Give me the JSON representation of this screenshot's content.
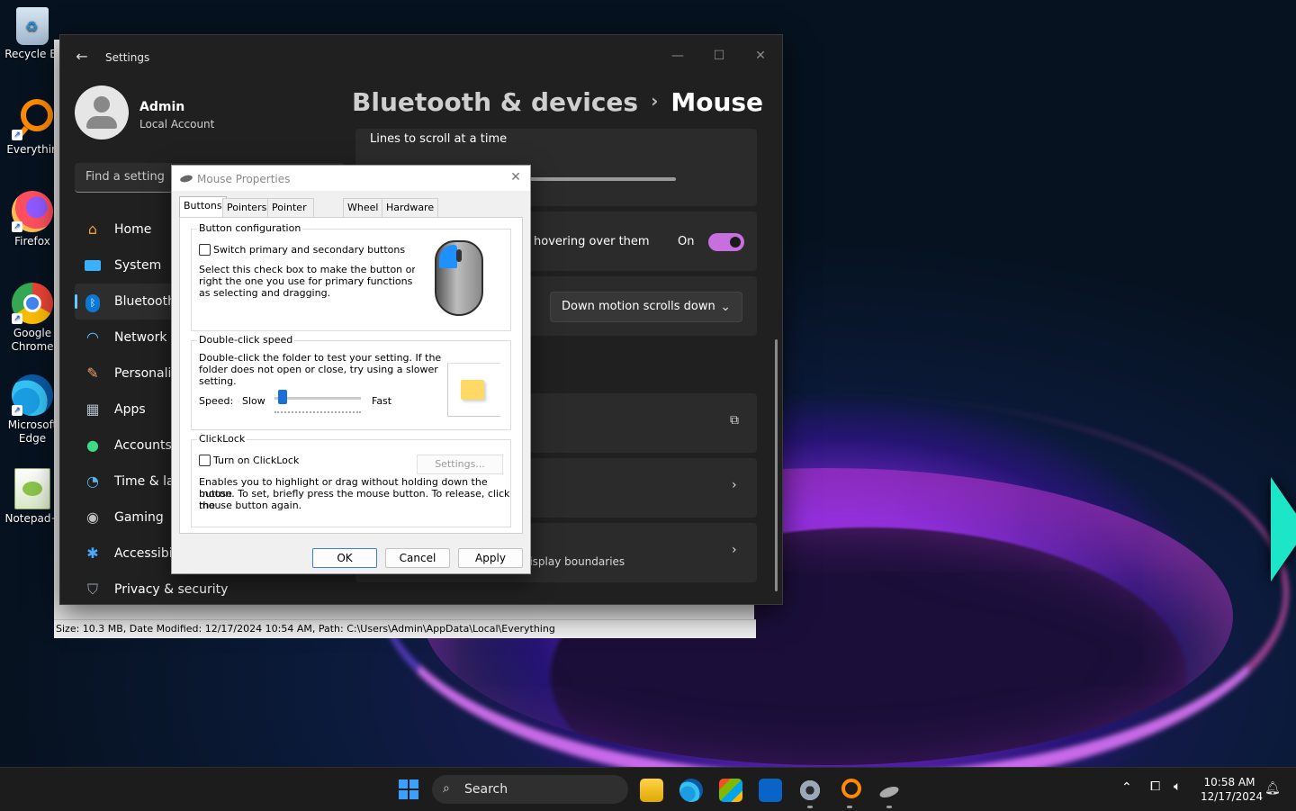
{
  "desktop": {
    "icons": [
      {
        "label": "Recycle Bi"
      },
      {
        "label": "Everythin"
      },
      {
        "label": "Firefox"
      },
      {
        "label": "Google Chrome"
      },
      {
        "label": "Microsoft Edge"
      },
      {
        "label": "Notepad+"
      }
    ]
  },
  "settings": {
    "title": "Settings",
    "user": {
      "name": "Admin",
      "account_type": "Local Account"
    },
    "search_placeholder": "Find a setting",
    "nav": [
      {
        "label": "Home",
        "icon": "home-icon"
      },
      {
        "label": "System",
        "icon": "monitor-icon"
      },
      {
        "label": "Bluetooth",
        "icon": "bluetooth-icon",
        "active": true
      },
      {
        "label": "Network &",
        "icon": "wifi-icon"
      },
      {
        "label": "Personaliz",
        "icon": "brush-icon"
      },
      {
        "label": "Apps",
        "icon": "apps-icon"
      },
      {
        "label": "Accounts",
        "icon": "person-icon"
      },
      {
        "label": "Time & lar",
        "icon": "clock-icon"
      },
      {
        "label": "Gaming",
        "icon": "gamepad-icon"
      },
      {
        "label": "Accessibili",
        "icon": "accessibility-icon"
      },
      {
        "label": "Privacy & security",
        "icon": "shield-icon"
      }
    ],
    "breadcrumb": {
      "parent": "Bluetooth & devices",
      "separator": "›",
      "current": "Mouse"
    },
    "cards": {
      "scroll_label": "Lines to scroll at a time",
      "hover_label": "hovering over them",
      "hover_state": "On",
      "scroll_direction": "Down motion scrolls down",
      "boundaries_label": "lisplay boundaries"
    },
    "accent_color": "#c86fe0"
  },
  "everything_status": {
    "text": "Size: 10.3 MB, Date Modified: 12/17/2024 10:54 AM, Path: C:\\Users\\Admin\\AppData\\Local\\Everything"
  },
  "dialog": {
    "title": "Mouse Properties",
    "tabs": [
      "Buttons",
      "Pointers",
      "Pointer Options",
      "Wheel",
      "Hardware"
    ],
    "active_tab": "Buttons",
    "button_config": {
      "title": "Button configuration",
      "switch_label": "Switch primary and secondary buttons",
      "switch_checked": false,
      "desc_lines": [
        "Select this check box to make the button on the",
        "right the one you use for primary functions such",
        "as selecting and dragging."
      ]
    },
    "double_click": {
      "title": "Double-click speed",
      "desc_lines": [
        "Double-click the folder to test your setting. If the",
        "folder does not open or close, try using a slower",
        "setting."
      ],
      "speed_label": "Speed:",
      "slow": "Slow",
      "fast": "Fast",
      "speed_fraction": 0.05
    },
    "clicklock": {
      "title": "ClickLock",
      "checkbox_label": "Turn on ClickLock",
      "checked": false,
      "settings_button": "Settings...",
      "desc_lines": [
        "Enables you to highlight or drag without holding down the mouse",
        "button. To set, briefly press the mouse button. To release, click the",
        "mouse button again."
      ]
    },
    "buttons": {
      "ok": "OK",
      "cancel": "Cancel",
      "apply": "Apply"
    }
  },
  "taskbar": {
    "search_label": "Search",
    "apps": [
      "file-explorer-icon",
      "edge-icon",
      "store-icon",
      "outlook-icon",
      "settings-icon",
      "everything-icon",
      "mouse-icon"
    ],
    "clock": {
      "time": "10:58 AM",
      "date": "12/17/2024"
    }
  }
}
